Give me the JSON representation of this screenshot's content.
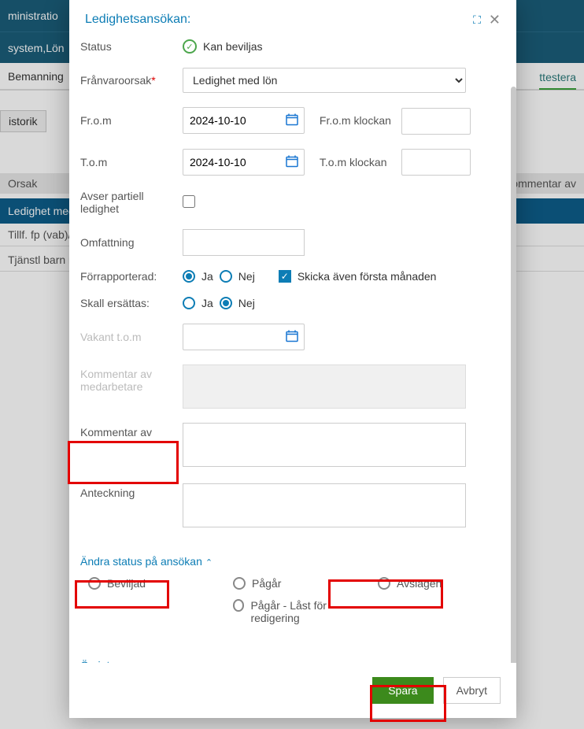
{
  "background": {
    "header_text": "ministratio",
    "subheader_text": "system,Lön",
    "tab_left": "Bemanning",
    "tab_right": "ttestera",
    "historik": "istorik",
    "table_header_left": "Orsak",
    "table_header_right": "ommentar av",
    "row1": "Ledighet med",
    "row2": "Tillf. fp (vab)/",
    "row3": "Tjänstl barn n"
  },
  "modal": {
    "title": "Ledighetsansökan:",
    "status_label": "Status",
    "status_value": "Kan beviljas",
    "reason_label": "Frånvaroorsak",
    "reason_value": "Ledighet med lön",
    "from_label": "Fr.o.m",
    "from_value": "2024-10-10",
    "from_time_label": "Fr.o.m klockan",
    "to_label": "T.o.m",
    "to_value": "2024-10-10",
    "to_time_label": "T.o.m klockan",
    "partial_label": "Avser partiell ledighet",
    "extent_label": "Omfattning",
    "prereported_label": "Förrapporterad:",
    "yes": "Ja",
    "no": "Nej",
    "send_first_month": "Skicka även första månaden",
    "replace_label": "Skall ersättas:",
    "vacant_label": "Vakant t.o.m",
    "employee_comment_label": "Kommentar av medarbetare",
    "manager_comment_label": "Kommentar av",
    "note_label": "Anteckning",
    "change_status_header": "Ändra status på ansökan",
    "status_approved": "Beviljad",
    "status_ongoing": "Pågår",
    "status_locked": "Pågår - Låst för redigering",
    "status_rejected": "Avslagen",
    "other_header": "Övrigt",
    "save_btn": "Spara",
    "cancel_btn": "Avbryt"
  }
}
